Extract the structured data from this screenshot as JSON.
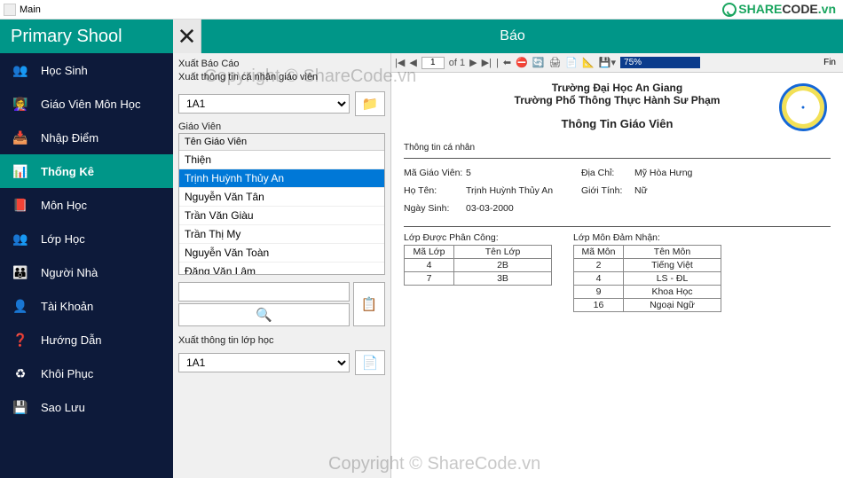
{
  "window": {
    "title": "Main"
  },
  "brand": {
    "text1": "SHARE",
    "text2": "CODE",
    "suffix": ".vn"
  },
  "sidebar": {
    "title": "Primary Shool",
    "items": [
      {
        "label": "Học Sinh",
        "icon": "👥"
      },
      {
        "label": "Giáo Viên Môn Học",
        "icon": "👩‍🏫"
      },
      {
        "label": "Nhập Điểm",
        "icon": "📥"
      },
      {
        "label": "Thống Kê",
        "icon": "📊"
      },
      {
        "label": "Môn Học",
        "icon": "📕"
      },
      {
        "label": "Lớp Học",
        "icon": "👥"
      },
      {
        "label": "Người Nhà",
        "icon": "👪"
      },
      {
        "label": "Tài Khoản",
        "icon": "👤"
      },
      {
        "label": "Hướng Dẫn",
        "icon": "❓"
      },
      {
        "label": "Khôi Phục",
        "icon": "♻"
      },
      {
        "label": "Sao Lưu",
        "icon": "💾"
      }
    ],
    "active_index": 3
  },
  "topbar": {
    "title": "Báo"
  },
  "panel": {
    "section1_label": "Xuất Báo Cáo",
    "section1_sub": "Xuất thông tin cá nhân giáo viên",
    "class_combo1": "1A1",
    "list_label": "Giáo Viên",
    "list_header": "Tên Giáo Viên",
    "teachers": [
      "Thiện",
      "Trịnh Huỳnh Thủy An",
      "Nguyễn Văn Tân",
      "Trần Văn Giàu",
      "Trần Thị My",
      "Nguyễn Văn Toàn",
      "Đặng Văn Lâm"
    ],
    "selected_teacher_index": 1,
    "section2_label": "Xuất thông tin lớp học",
    "class_combo2": "1A1"
  },
  "report": {
    "toolbar": {
      "page_current": "1",
      "page_of": "of  1",
      "zoom": "75%",
      "find": "Fin"
    },
    "header_line1": "Trường Đại Học An Giang",
    "header_line2": "Trường Phổ Thông Thực Hành Sư Phạm",
    "title": "Thông Tin Giáo Viên",
    "sub": "Thông tin cá nhân",
    "fields": {
      "id_k": "Mã Giáo Viên:",
      "id_v": "5",
      "addr_k": "Địa Chỉ:",
      "addr_v": "Mỹ Hòa Hưng",
      "name_k": "Họ Tên:",
      "name_v": "Trịnh Huỳnh Thủy An",
      "gender_k": "Giới Tính:",
      "gender_v": "Nữ",
      "dob_k": "Ngày Sinh:",
      "dob_v": "03-03-2000"
    },
    "table1": {
      "title": "Lớp Được Phân Công:",
      "cols": [
        "Mã Lớp",
        "Tên Lớp"
      ],
      "rows": [
        [
          "4",
          "2B"
        ],
        [
          "7",
          "3B"
        ]
      ]
    },
    "table2": {
      "title": "Lớp Môn Đảm Nhận:",
      "cols": [
        "Mã Môn",
        "Tên Môn"
      ],
      "rows": [
        [
          "2",
          "Tiếng Việt"
        ],
        [
          "4",
          "LS - ĐL"
        ],
        [
          "9",
          "Khoa Học"
        ],
        [
          "16",
          "Ngoại Ngữ"
        ]
      ]
    }
  },
  "watermark": "Copyright © ShareCode.vn"
}
